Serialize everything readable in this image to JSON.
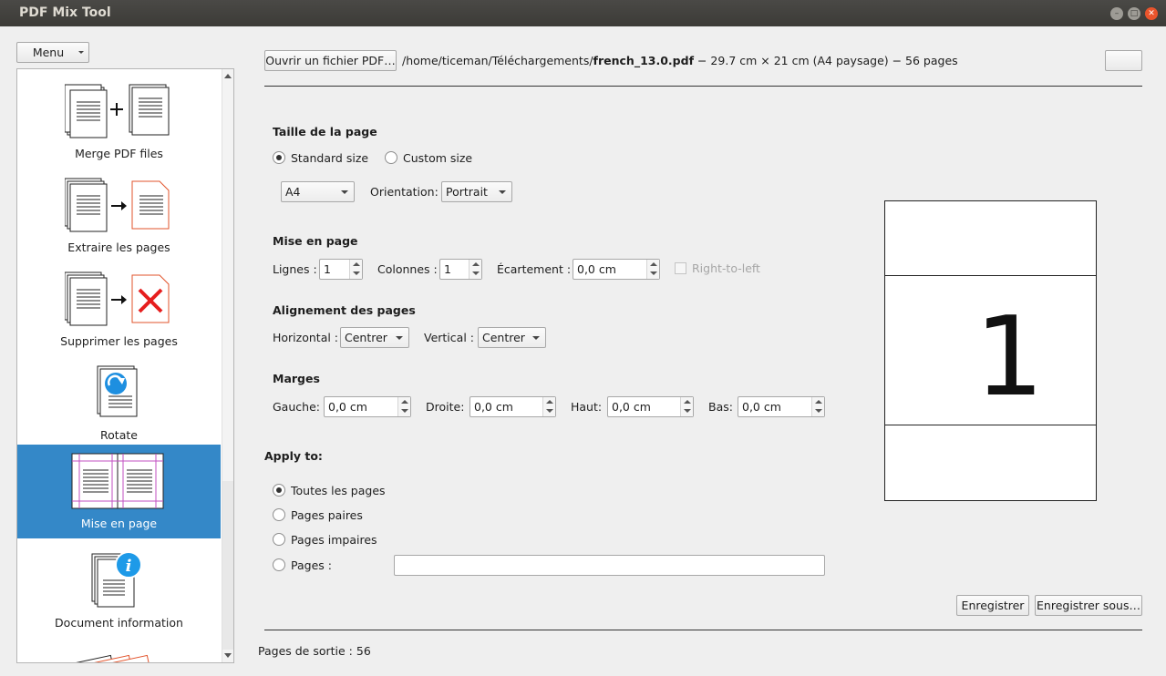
{
  "window": {
    "title": "PDF Mix Tool",
    "minimize": "–",
    "maximize": "□",
    "close": "✕"
  },
  "sidebar": {
    "menu_label": "Menu",
    "items": [
      {
        "label": "Merge PDF files",
        "icon": "merge-icon"
      },
      {
        "label": "Extraire les pages",
        "icon": "extract-pages-icon"
      },
      {
        "label": "Supprimer les pages",
        "icon": "delete-pages-icon"
      },
      {
        "label": "Rotate",
        "icon": "rotate-icon"
      },
      {
        "label": "Mise en page",
        "icon": "page-layout-icon",
        "selected": true
      },
      {
        "label": "Document information",
        "icon": "info-icon"
      }
    ]
  },
  "file": {
    "open_button": "Ouvrir un fichier PDF…",
    "path_prefix": "/home/ticeman/Téléchargements/",
    "filename": "french_13.0.pdf",
    "info": " − 29.7 cm × 21 cm (A4 paysage) − 56 pages"
  },
  "page_size": {
    "heading": "Taille de la page",
    "standard_label": "Standard size",
    "custom_label": "Custom size",
    "selected": "standard",
    "size_value": "A4",
    "orientation_label": "Orientation:",
    "orientation_value": "Portrait"
  },
  "layout": {
    "heading": "Mise en page",
    "rows_label": "Lignes :",
    "rows_value": "1",
    "cols_label": "Colonnes :",
    "cols_value": "1",
    "spacing_label": "Écartement :",
    "spacing_value": "0,0 cm",
    "rtl_label": "Right-to-left"
  },
  "alignment": {
    "heading": "Alignement des pages",
    "horizontal_label": "Horizontal :",
    "horizontal_value": "Centrer",
    "vertical_label": "Vertical :",
    "vertical_value": "Centrer"
  },
  "margins": {
    "heading": "Marges",
    "left_label": "Gauche:",
    "left_value": "0,0 cm",
    "right_label": "Droite:",
    "right_value": "0,0 cm",
    "top_label": "Haut:",
    "top_value": "0,0 cm",
    "bottom_label": "Bas:",
    "bottom_value": "0,0 cm"
  },
  "apply_to": {
    "heading": "Apply to:",
    "all": "Toutes les pages",
    "even": "Pages paires",
    "odd": "Pages impaires",
    "pages": "Pages :",
    "pages_value": "",
    "selected": "all"
  },
  "preview": {
    "page_number": "1"
  },
  "actions": {
    "save": "Enregistrer",
    "save_as": "Enregistrer sous…"
  },
  "status": {
    "output_pages": "Pages de sortie : 56"
  }
}
